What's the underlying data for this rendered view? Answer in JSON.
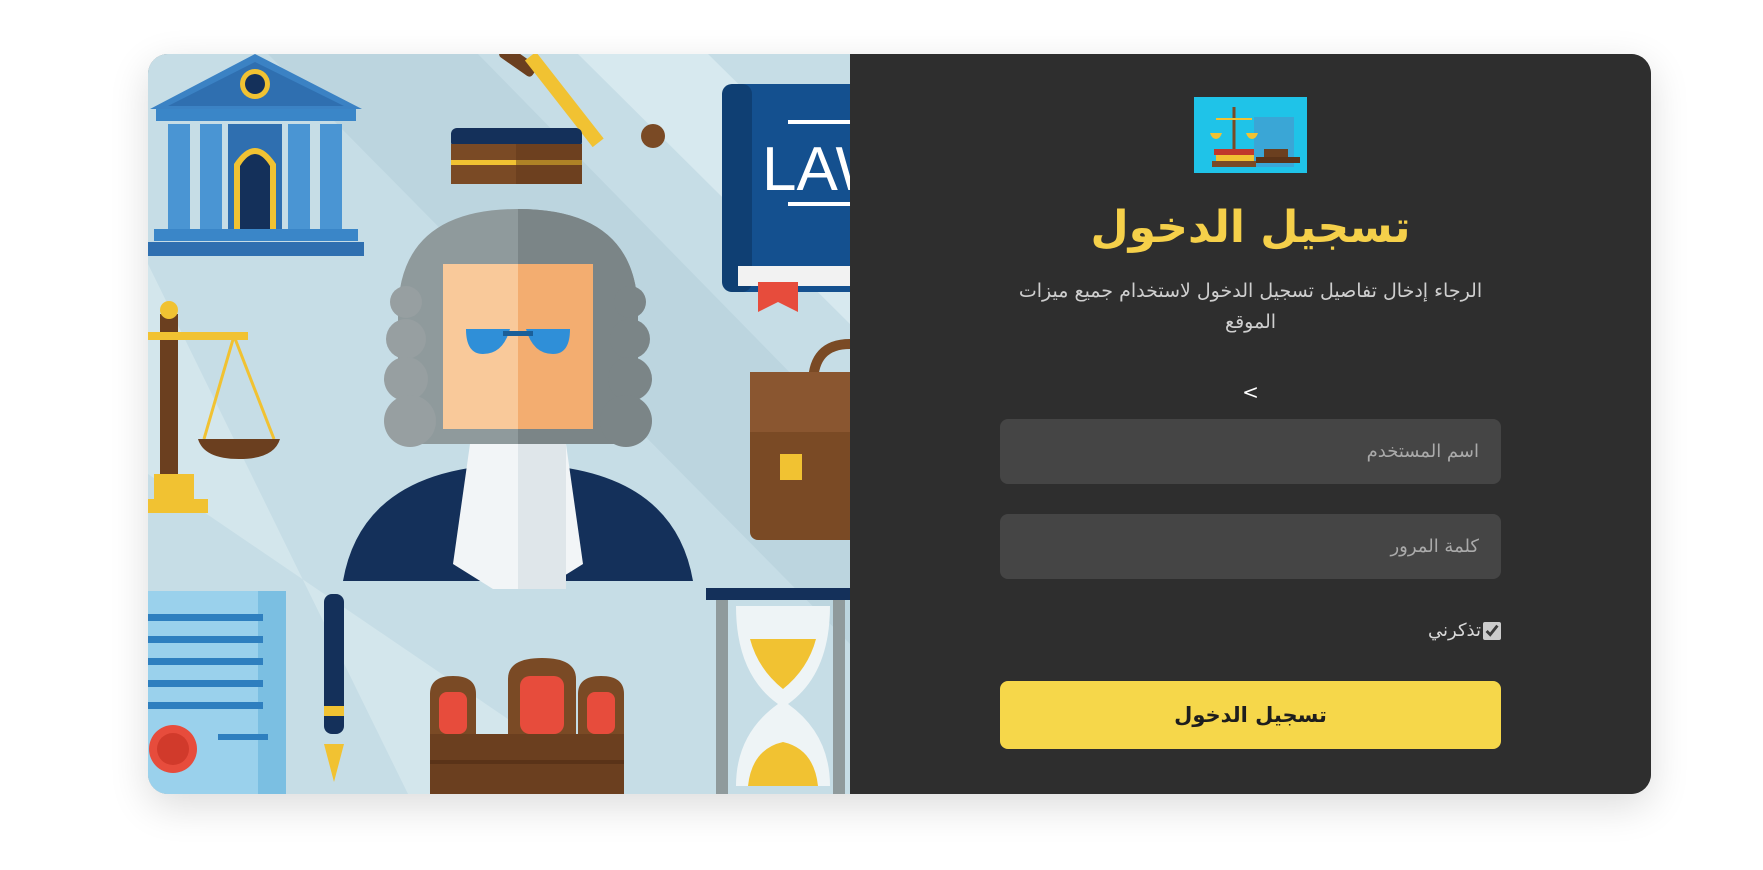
{
  "login": {
    "title": "تسجيل الدخول",
    "subtitle": "الرجاء إدخال تفاصيل تسجيل الدخول لاستخدام جميع ميزات الموقع",
    "stray_mark": ">",
    "username_placeholder": "اسم المستخدم",
    "password_placeholder": "كلمة المرور",
    "remember_label": "تذكرني",
    "remember_checked": true,
    "submit_label": "تسجيل الدخول"
  },
  "illustration": {
    "book_text": "LAW"
  },
  "colors": {
    "accent": "#f6d74a",
    "panel": "#2e2e2e",
    "input": "#454545",
    "logo_bg": "#1fc3e8"
  }
}
